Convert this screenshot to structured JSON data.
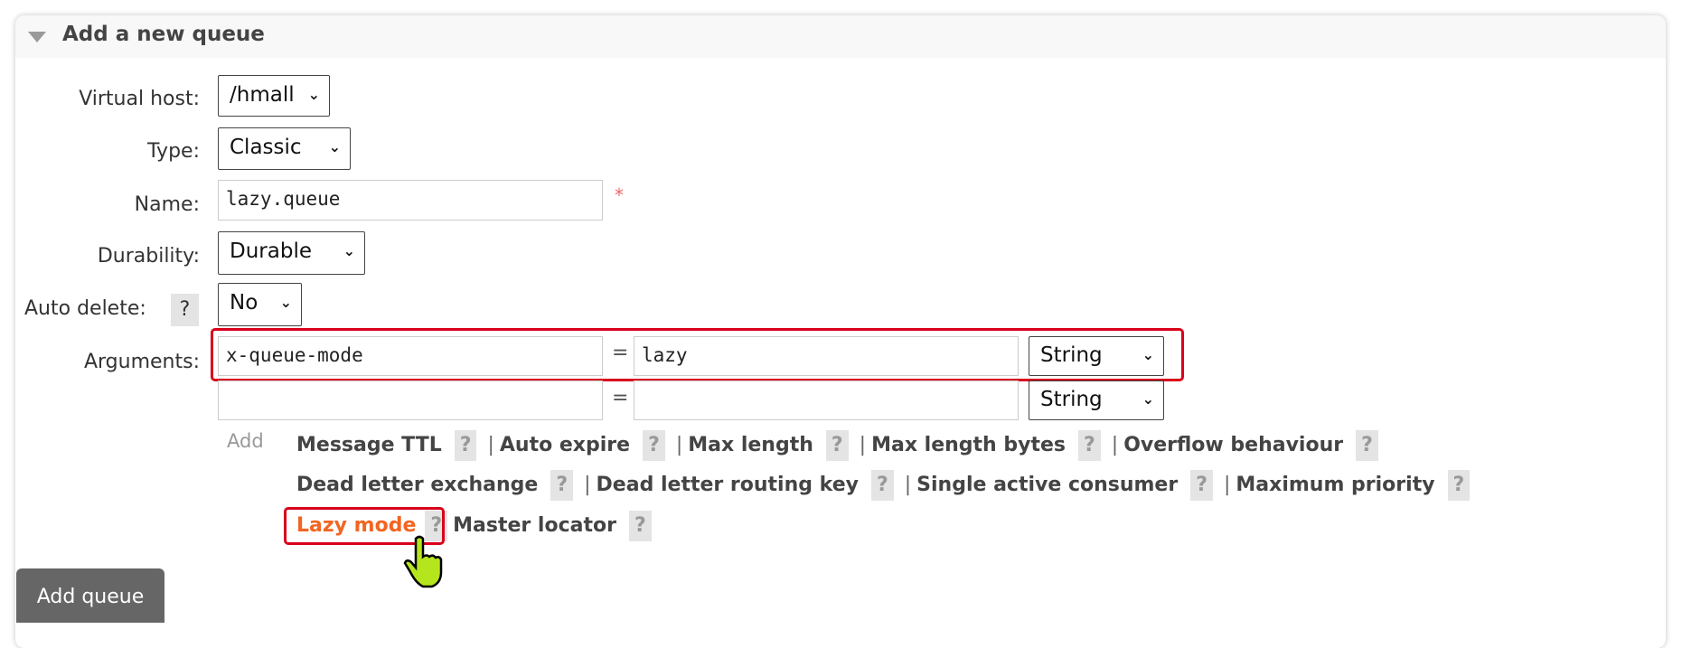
{
  "section": {
    "title": "Add a new queue"
  },
  "form": {
    "virtual_host": {
      "label": "Virtual host:",
      "value": "/hmall"
    },
    "type": {
      "label": "Type:",
      "value": "Classic"
    },
    "name": {
      "label": "Name:",
      "value": "lazy.queue",
      "required_mark": "*"
    },
    "durability": {
      "label": "Durability:",
      "value": "Durable"
    },
    "auto_delete": {
      "label": "Auto delete:",
      "help": "?",
      "value": "No"
    },
    "arguments": {
      "label": "Arguments:",
      "rows": [
        {
          "key": "x-queue-mode",
          "eq": "=",
          "value": "lazy",
          "type": "String"
        },
        {
          "key": "",
          "eq": "=",
          "value": "",
          "type": "String"
        }
      ]
    }
  },
  "add_label": "Add",
  "help": "?",
  "separator": "|",
  "arg_links": [
    [
      "Message TTL",
      "Auto expire",
      "Max length",
      "Max length bytes",
      "Overflow behaviour"
    ],
    [
      "Dead letter exchange",
      "Dead letter routing key",
      "Single active consumer",
      "Maximum priority"
    ],
    [
      "Lazy mode",
      "Master locator"
    ]
  ],
  "submit": "Add queue",
  "colors": {
    "highlight": "#d9001b",
    "active_link": "#f26522",
    "cursor": "#b5e61d"
  }
}
